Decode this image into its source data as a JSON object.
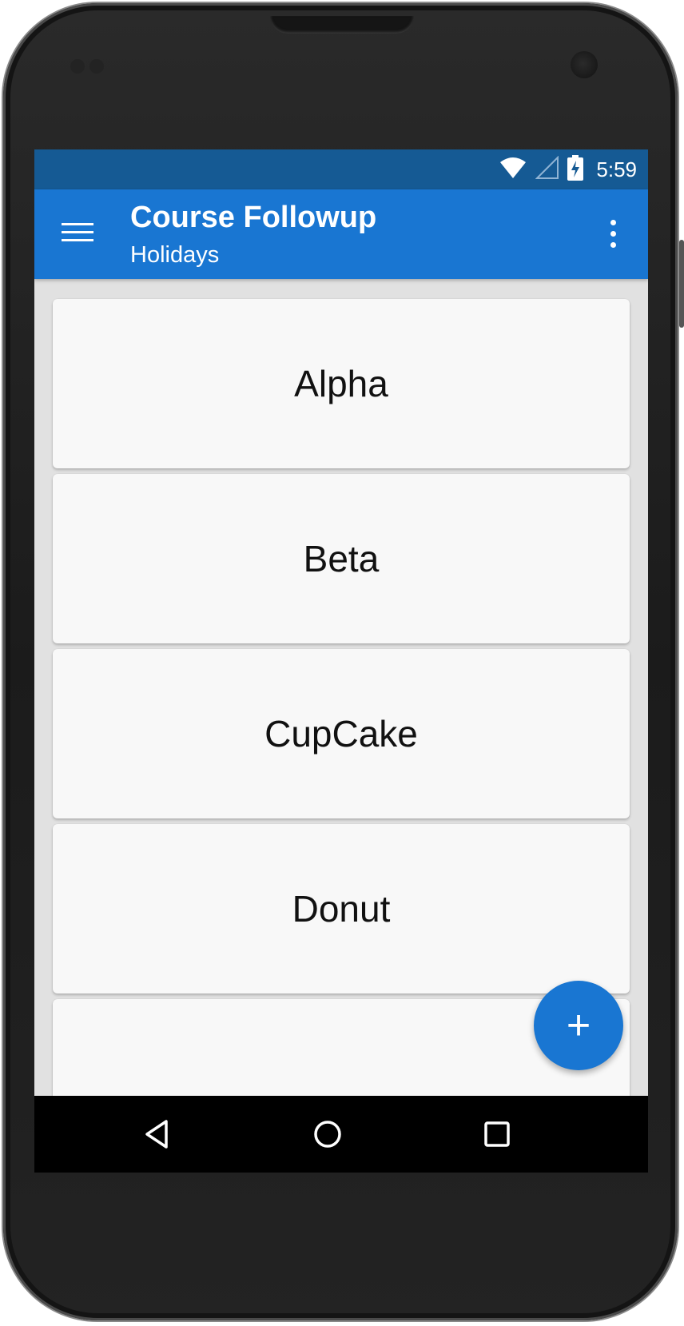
{
  "status_bar": {
    "time": "5:59",
    "icons": [
      "wifi-icon",
      "cell-signal-icon",
      "battery-charging-icon"
    ]
  },
  "app_bar": {
    "title": "Course Followup",
    "subtitle": "Holidays",
    "menu_icon": "hamburger-menu-icon",
    "overflow_icon": "more-vertical-icon"
  },
  "list": {
    "items": [
      {
        "label": "Alpha"
      },
      {
        "label": "Beta"
      },
      {
        "label": "CupCake"
      },
      {
        "label": "Donut"
      },
      {
        "label": ""
      }
    ]
  },
  "fab": {
    "label": "+",
    "icon": "add-icon"
  },
  "nav_bar": {
    "icons": [
      "back-icon",
      "home-icon",
      "recents-icon"
    ]
  },
  "colors": {
    "status_bar": "#155a94",
    "app_bar": "#1976d2",
    "fab": "#1976d2",
    "background": "#e1e1e1",
    "card": "#f8f8f8"
  }
}
